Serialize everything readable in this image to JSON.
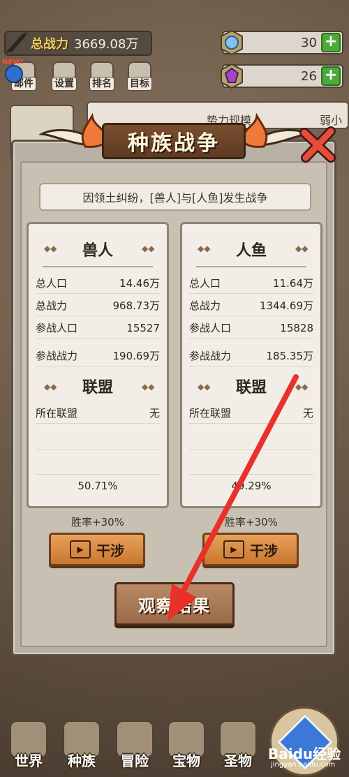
{
  "hud": {
    "power_label": "总战力",
    "power_value": "3669.08万",
    "resource_1_value": "30",
    "resource_2_value": "26",
    "plus_symbol": "+"
  },
  "menu": [
    {
      "label": "邮件"
    },
    {
      "label": "设置"
    },
    {
      "label": "排名"
    },
    {
      "label": "目标"
    }
  ],
  "new_badge": "NEW!",
  "background_card": {
    "title": "势力规模",
    "right_text": "弱小"
  },
  "dialog": {
    "title": "种族战争",
    "reason": "因领土纠纷，[兽人]与[人鱼]发生战争",
    "row_labels": {
      "population": "总人口",
      "power": "总战力",
      "war_population": "参战人口",
      "war_power": "参战战力"
    },
    "alliance_title": "联盟",
    "alliance_label": "所在联盟",
    "left": {
      "name": "兽人",
      "population": "14.46万",
      "power": "968.73万",
      "war_population": "15527",
      "war_power": "190.69万",
      "alliance": "无",
      "percent": "50.71%"
    },
    "right": {
      "name": "人鱼",
      "population": "11.64万",
      "power": "1344.69万",
      "war_population": "15828",
      "war_power": "185.35万",
      "alliance": "无",
      "percent": "49.29%"
    },
    "win_rate": "胜率+30%",
    "meddle_label": "干涉",
    "observe_label": "观察结果"
  },
  "bottom_nav": [
    {
      "label": "世界"
    },
    {
      "label": "种族"
    },
    {
      "label": "冒险"
    },
    {
      "label": "宝物"
    },
    {
      "label": "圣物"
    }
  ],
  "watermark": {
    "line1": "Baidu经验",
    "line2": "jingyan.baidu.com"
  },
  "colors": {
    "accent_green": "#4caa3a",
    "wood": "#c9762f",
    "annotation_arrow": "#e8312a"
  }
}
